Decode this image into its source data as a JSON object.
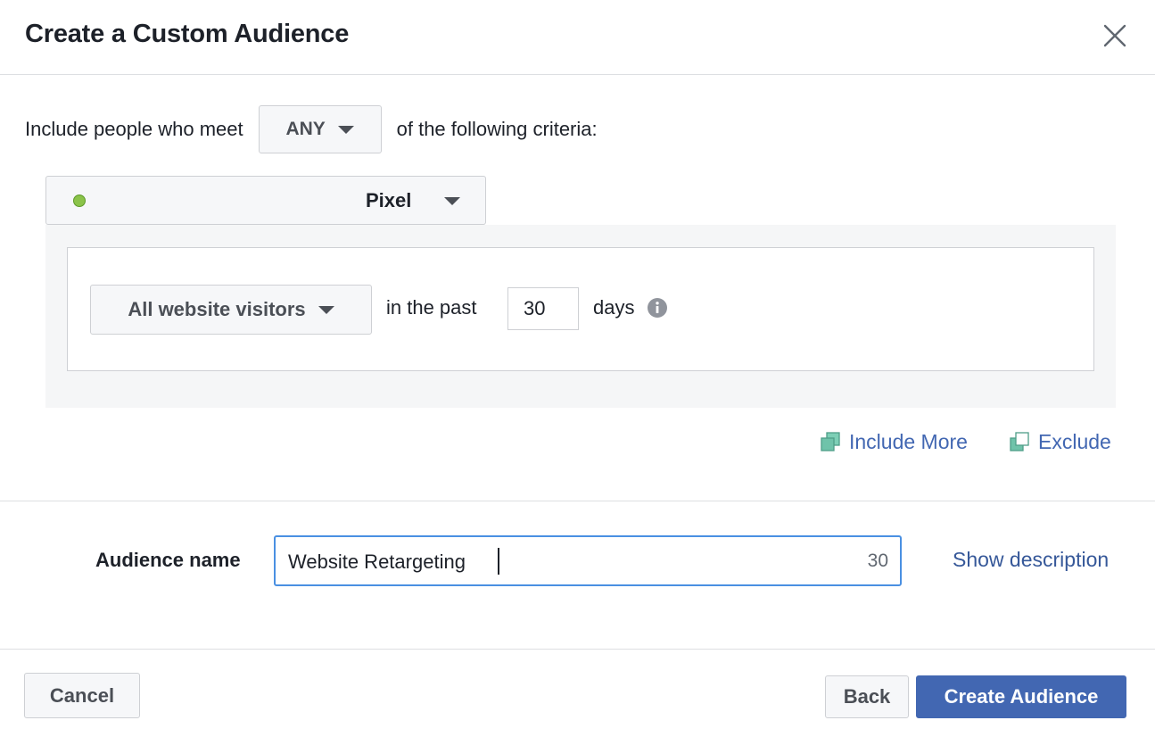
{
  "dialog": {
    "title": "Create a Custom Audience"
  },
  "criteria": {
    "prefix": "Include people who meet",
    "match": "ANY",
    "suffix": "of the following criteria:"
  },
  "pixel": {
    "label": "Pixel",
    "status_color": "#8bc34a"
  },
  "rule": {
    "event": "All website visitors",
    "past_label": "in the past",
    "days_value": "30",
    "days_label": "days"
  },
  "actions": {
    "include_more": "Include More",
    "exclude": "Exclude"
  },
  "audience": {
    "label": "Audience name",
    "value": "Website Retargeting",
    "char_count": "30",
    "show_description": "Show description"
  },
  "footer": {
    "cancel": "Cancel",
    "back": "Back",
    "create": "Create Audience"
  },
  "colors": {
    "primary": "#4267b2",
    "link": "#365899",
    "focus_border": "#4a90e2"
  },
  "icons": {
    "close": "close-icon",
    "dropdown": "caret-down-icon",
    "info": "info-icon",
    "include": "include-icon",
    "exclude": "exclude-icon"
  }
}
